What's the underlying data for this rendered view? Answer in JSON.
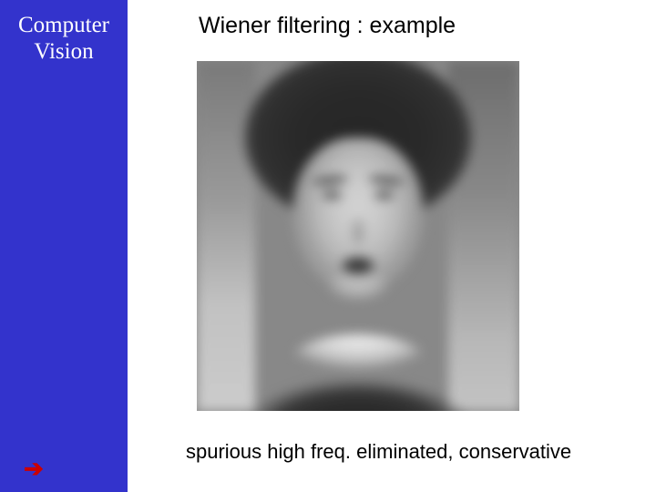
{
  "sidebar": {
    "line1": "Computer",
    "line2": "Vision",
    "arrow_glyph": "➔"
  },
  "slide": {
    "title": "Wiener filtering  : example",
    "caption": "spurious high freq. eliminated, conservative",
    "image_alt": "blurred-grayscale-portrait"
  }
}
